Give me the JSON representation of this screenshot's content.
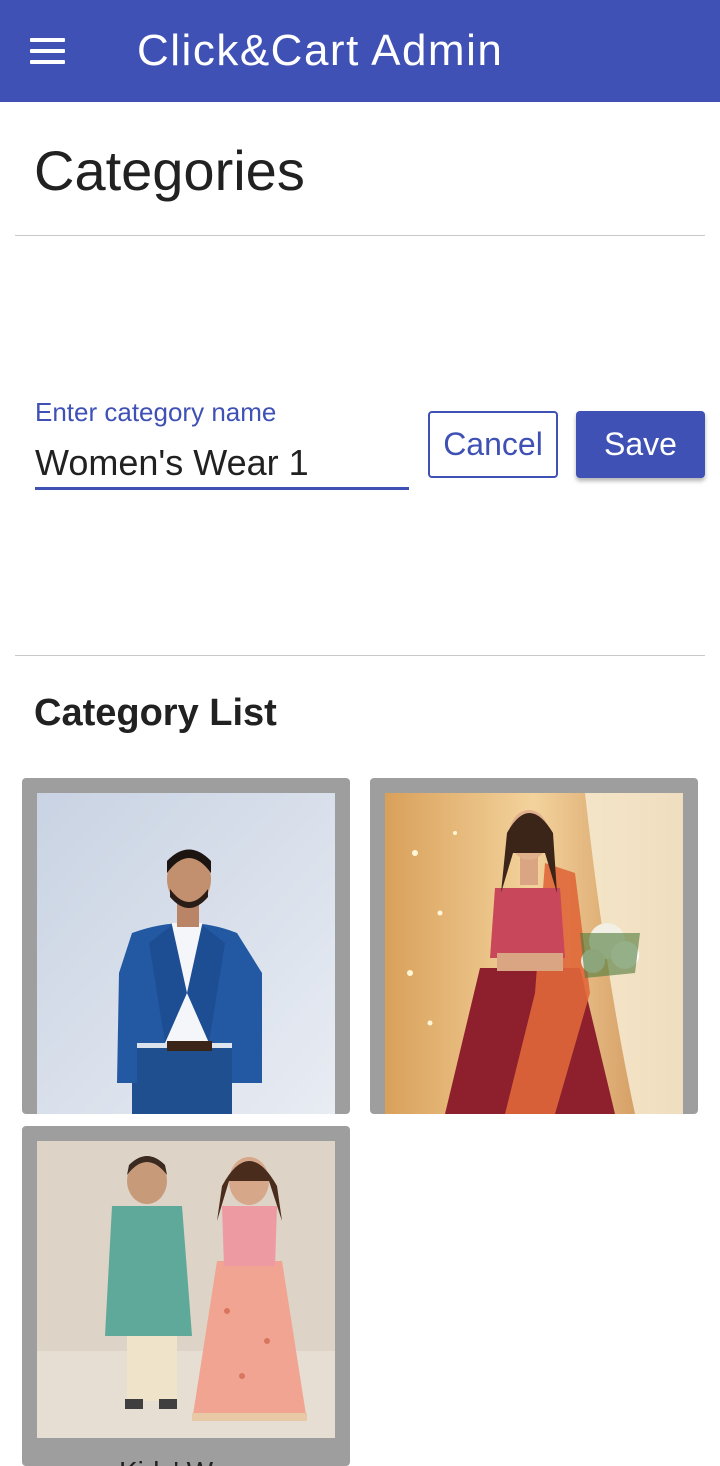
{
  "appbar": {
    "title": "Click&Cart Admin",
    "menu_icon": "menu-icon",
    "color": "#3f51b5"
  },
  "page": {
    "title": "Categories"
  },
  "form": {
    "label": "Enter category name",
    "value": "Women's Wear 1",
    "cancel_label": "Cancel",
    "save_label": "Save"
  },
  "list": {
    "title": "Category List",
    "cards": [
      {
        "image": "men-suit-photo",
        "label": ""
      },
      {
        "image": "women-lehenga-photo",
        "label": ""
      },
      {
        "image": "kids-ethnic-photo",
        "label": "Kids' Wear"
      }
    ]
  }
}
